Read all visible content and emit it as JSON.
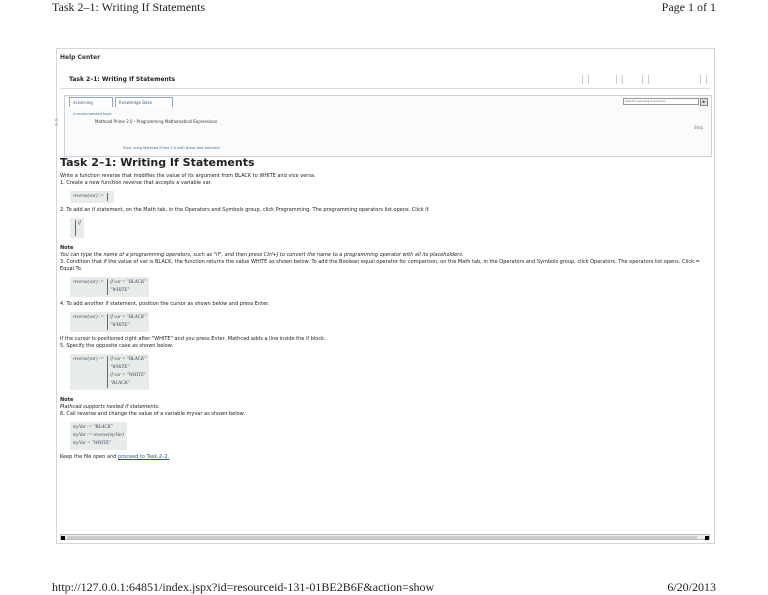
{
  "print_header": {
    "title": "Task 2–1: Writing If Statements",
    "page": "Page 1 of 1"
  },
  "print_footer": {
    "url": "http://127.0.0.1:64851/index.jspx?id=resourceid-131-01BE2B6F&action=show",
    "date": "6/20/2013"
  },
  "help_center": "Help Center",
  "task_header": "Task 2–1: Writing If Statements",
  "tabs": [
    "eLearning",
    "Knowledge Base"
  ],
  "recommended_topic_label": "A recommended topic",
  "recommended_topic_link": "Mathcad Prime 2.0 - Programming Mathematical Expressions",
  "start_link": "Start using Mathcad Prime 2.0 with these free tutorials!",
  "search_placeholder": "Search Learning Connector",
  "stop_link": "Stop",
  "content": {
    "heading": "Task 2–1: Writing If Statements",
    "intro": "Write a function reverse that modifies the value of its argument from BLACK to WHITE and vice versa.",
    "step1": "1.  Create a new function reverse that accepts a variable var.",
    "code1": "reverse(var) :=",
    "step2": "2.  To add an if statement, on the Math tab, in the Operators and Symbols group, click Programming. The programming operators list opens. Click if.",
    "code2": "if",
    "note1_h": "Note",
    "note1_b": "You can type the name of a programming operators, such as \"if\", and then press Ctrl+J to convert the name to a programming operator with all its placeholders.",
    "step3": "3.  Condition that if the value of var is BLACK, the function returns the value WHITE as shown below. To add the Boolean equal operator for comparison, on the Math tab, in the Operators and Symbols group, click Operators. The operators list opens. Click = Equal To.",
    "code3_a": "reverse(var) :=",
    "code3_b": "if var = \"BLACK\"",
    "code3_c": "\"WHITE\"",
    "step4": "4.  To add another if statement, position the cursor as shown below and press Enter.",
    "code4_a": "reverse(var) :=",
    "code4_b": "if var = \"BLACK\"",
    "code4_c": "\"WHITE\"",
    "after4": "If the cursor is positioned right after \"WHITE\" and you press Enter, Mathcad adds a line inside the if block.",
    "step5": "5.  Specify the opposite case as shown below.",
    "code5_a": "reverse(var) :=",
    "code5_b": "if var = \"BLACK\"",
    "code5_c": "\"WHITE\"",
    "code5_d": "if var = \"WHITE\"",
    "code5_e": "\"BLACK\"",
    "note2_h": "Note",
    "note2_b": "Mathcad supports nested if statements.",
    "step6": "6.  Call reverse and change the value of a variable myvar as shown below.",
    "code6_a": "myVar := \"BLACK\"",
    "code6_b": "myVar := reverse(myVar)",
    "code6_c": "myVar = \"WHITE\"",
    "closing_pre": "Keep the file open and ",
    "closing_link": "proceed to Task 2–2."
  }
}
